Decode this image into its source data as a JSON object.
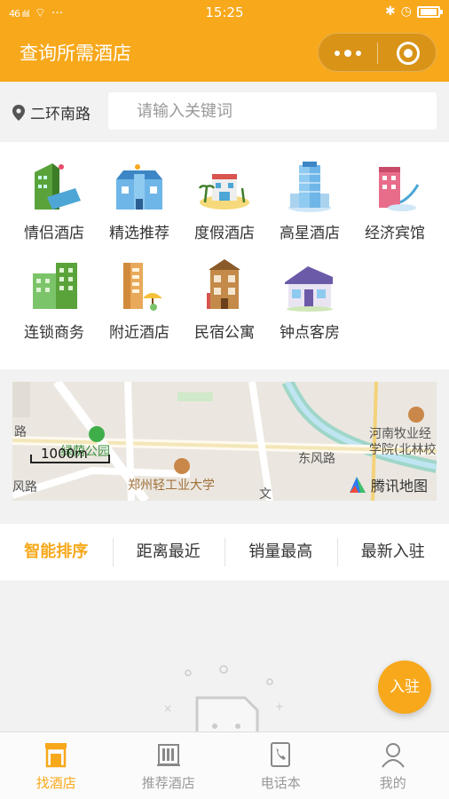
{
  "status": {
    "time": "15:25",
    "signal": "46 ılıl",
    "wifi": "⌔",
    "more": "···"
  },
  "header": {
    "title": "查询所需酒店"
  },
  "search": {
    "location": "二环南路",
    "placeholder": "请输入关键词"
  },
  "categories": [
    {
      "label": "情侣酒店",
      "icon": "couple-hotel-icon"
    },
    {
      "label": "精选推荐",
      "icon": "featured-hotel-icon"
    },
    {
      "label": "度假酒店",
      "icon": "resort-hotel-icon"
    },
    {
      "label": "高星酒店",
      "icon": "luxury-hotel-icon"
    },
    {
      "label": "经济宾馆",
      "icon": "budget-hotel-icon"
    },
    {
      "label": "连锁商务",
      "icon": "chain-business-icon"
    },
    {
      "label": "附近酒店",
      "icon": "nearby-hotel-icon"
    },
    {
      "label": "民宿公寓",
      "icon": "homestay-icon"
    },
    {
      "label": "钟点客房",
      "icon": "hourly-room-icon"
    }
  ],
  "map": {
    "labels": {
      "park": "绿荫公园",
      "university": "郑州轻工业大学",
      "college_line1": "河南牧业经",
      "college_line2": "学院(北林校",
      "road1": "东风路",
      "road2": "风路",
      "road3": "路",
      "wen": "文"
    },
    "scale": "1000m",
    "brand": "腾讯地图"
  },
  "sort_tabs": [
    "智能排序",
    "距离最近",
    "销量最高",
    "最新入驻"
  ],
  "fab": {
    "label": "入驻"
  },
  "bottom_nav": [
    {
      "label": "找酒店"
    },
    {
      "label": "推荐酒店"
    },
    {
      "label": "电话本"
    },
    {
      "label": "我的"
    }
  ],
  "colors": {
    "accent": "#f7a81b",
    "text": "#333333",
    "muted": "#999999"
  }
}
